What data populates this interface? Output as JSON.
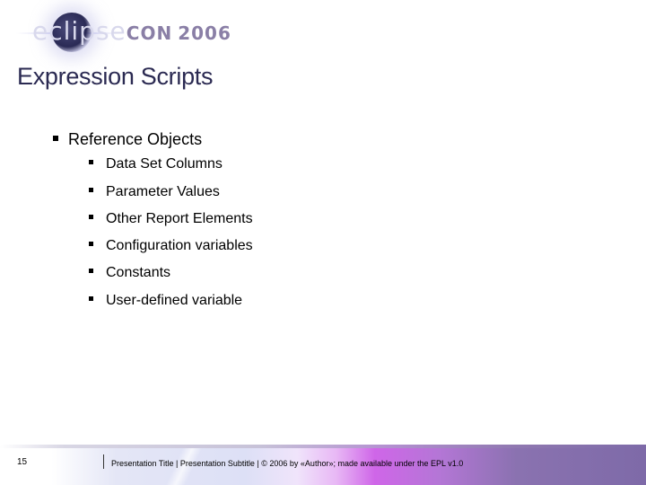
{
  "logo": {
    "prefix": "eclipse",
    "brand": "CON",
    "year": "2006"
  },
  "slide": {
    "title": "Expression Scripts",
    "bullets": [
      {
        "text": "Reference Objects",
        "children": [
          "Data Set Columns",
          "Parameter Values",
          "Other Report Elements",
          "Configuration variables",
          "Constants",
          "User-defined variable"
        ]
      }
    ]
  },
  "footer": {
    "page_number": "15",
    "text": "Presentation Title  |  Presentation Subtitle  |  © 2006 by «Author»; made available under the EPL v1.0"
  }
}
